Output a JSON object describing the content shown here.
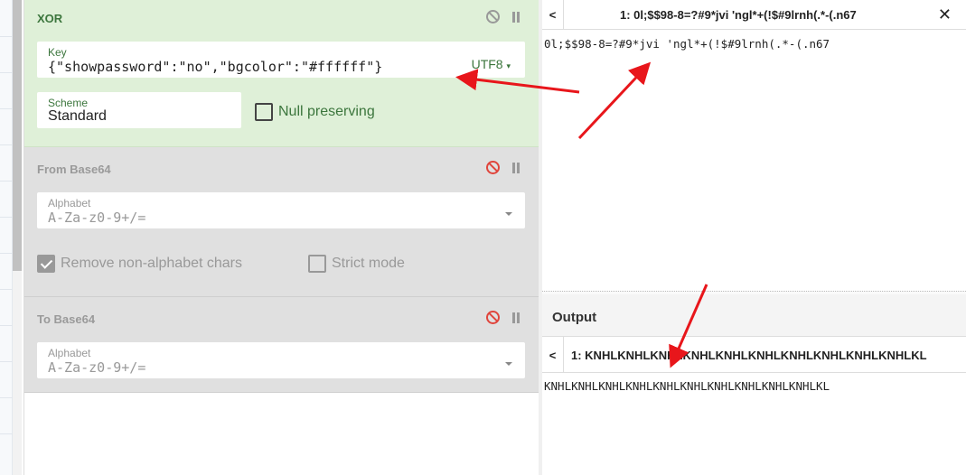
{
  "recipe": {
    "xor": {
      "title": "XOR",
      "key_label": "Key",
      "key_value": "{\"showpassword\":\"no\",\"bgcolor\":\"#ffffff\"}",
      "key_encoding": "UTF8",
      "scheme_label": "Scheme",
      "scheme_value": "Standard",
      "null_preserving_label": "Null preserving",
      "null_preserving_checked": false
    },
    "from_base64": {
      "title": "From Base64",
      "alphabet_label": "Alphabet",
      "alphabet_value": "A-Za-z0-9+/=",
      "remove_nonalpha_label": "Remove non-alphabet chars",
      "remove_nonalpha_checked": true,
      "strict_mode_label": "Strict mode",
      "strict_mode_checked": false,
      "disabled": true
    },
    "to_base64": {
      "title": "To Base64",
      "alphabet_label": "Alphabet",
      "alphabet_value": "A-Za-z0-9+/=",
      "disabled": true
    }
  },
  "input": {
    "tab_prev": "<",
    "tab_title": "1: 0l;$$98-8=?#9*jvi 'ngl*+(!$#9lrnh(.*-(.n67",
    "text": "0l;$$98-8=?#9*jvi 'ngl*+(!$#9lrnh(.*-(.n67"
  },
  "output": {
    "header": "Output",
    "tab_prev": "<",
    "tab_title": "1: KNHLKNHLKNHLKNHLKNHLKNHLKNHLKNHLKNHLKNHLKL",
    "text": "KNHLKNHLKNHLKNHLKNHLKNHLKNHLKNHLKNHLKNHLKL"
  },
  "icons": {
    "disable": "disable-icon",
    "pause": "pause-icon",
    "close": "close-icon",
    "dropdown": "chevron-down-icon"
  },
  "colors": {
    "xor_bg": "#dff0d8",
    "xor_text": "#3c763d",
    "disabled_op_bg": "#e0e0e0",
    "annotation_arrow": "#e8161b"
  }
}
